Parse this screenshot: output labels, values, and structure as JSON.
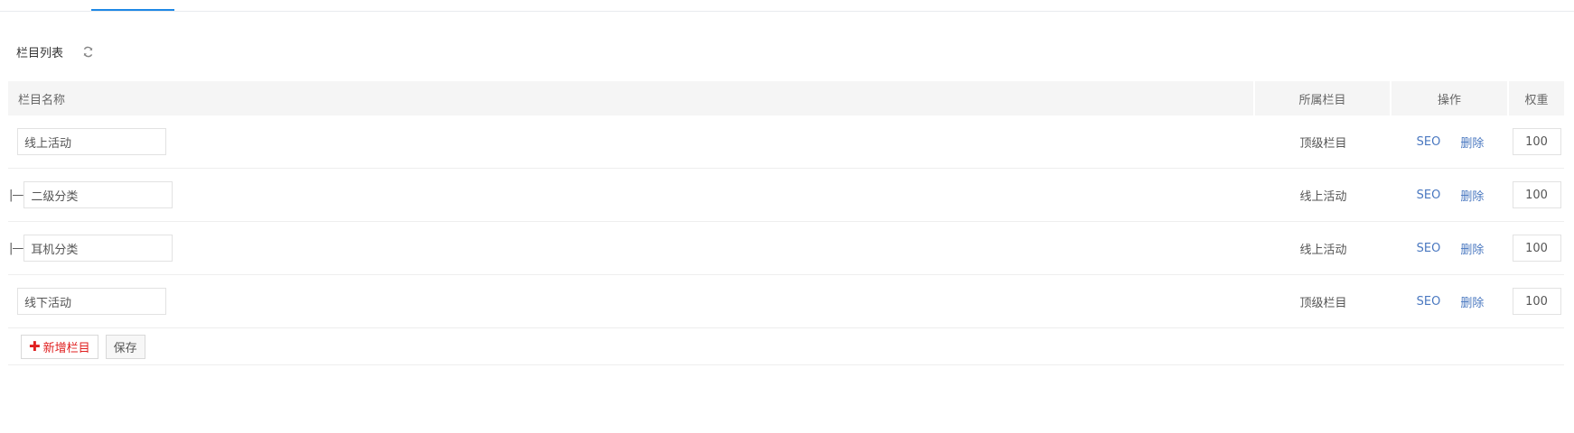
{
  "section": {
    "title": "栏目列表",
    "refresh_icon": "refresh-icon"
  },
  "table": {
    "headers": {
      "name": "栏目名称",
      "parent": "所属栏目",
      "ops": "操作",
      "weight": "权重"
    },
    "rows": [
      {
        "prefix": "",
        "name": "线上活动",
        "parent": "顶级栏目",
        "seo": "SEO",
        "delete": "删除",
        "weight": "100"
      },
      {
        "prefix": "|—",
        "name": "二级分类",
        "parent": "线上活动",
        "seo": "SEO",
        "delete": "删除",
        "weight": "100"
      },
      {
        "prefix": "|—",
        "name": "耳机分类",
        "parent": "线上活动",
        "seo": "SEO",
        "delete": "删除",
        "weight": "100"
      },
      {
        "prefix": "",
        "name": "线下活动",
        "parent": "顶级栏目",
        "seo": "SEO",
        "delete": "删除",
        "weight": "100"
      }
    ]
  },
  "actions": {
    "add_label": "新增栏目",
    "add_icon": "plus-icon",
    "save_label": "保存"
  },
  "colors": {
    "accent": "#1e88e5",
    "link": "#4a78c0",
    "danger": "#e02020"
  }
}
